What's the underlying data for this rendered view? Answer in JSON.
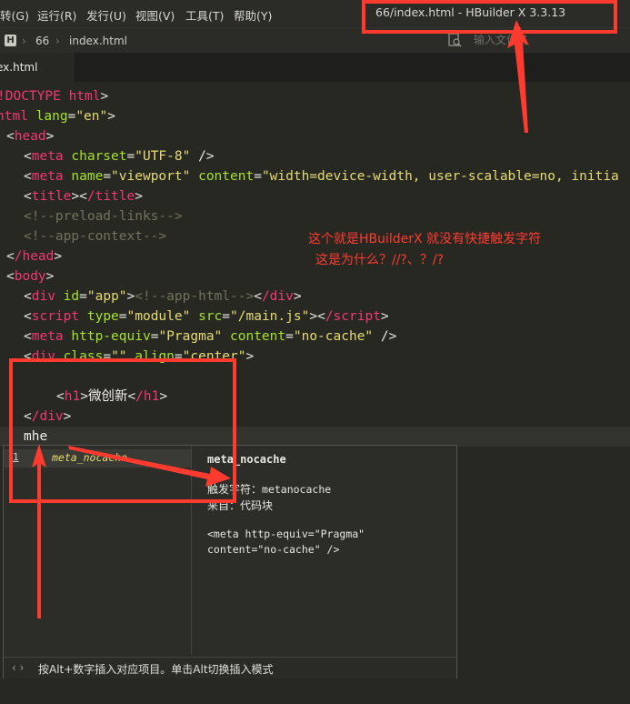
{
  "menu": [
    "转(G)",
    "运行(R)",
    "发行(U)",
    "视图(V)",
    "工具(T)",
    "帮助(Y)"
  ],
  "window_title": "66/index.html - HBuilder X 3.3.13",
  "breadcrumb": {
    "logo": "H",
    "project": "66",
    "file": "index.html"
  },
  "file_search_placeholder": "输入文件名",
  "tab": {
    "label": "ex.html"
  },
  "code": {
    "l1_doctype": "!DOCTYPE",
    "l1_html": "html",
    "l2_tag": "html",
    "l2_attr": "lang",
    "l2_val": "\"en\"",
    "l3_tag": "head",
    "l4_tag": "meta",
    "l4_attr": "charset",
    "l4_val": "\"UTF-8\"",
    "l5_tag": "meta",
    "l5_attr1": "name",
    "l5_val1": "\"viewport\"",
    "l5_attr2": "content",
    "l5_val2": "\"width=device-width, user-scalable=no, initia",
    "l6_tag": "title",
    "l6_tag_close": "/title",
    "l7_cmt": "<!--preload-links-->",
    "l8_cmt": "<!--app-context-->",
    "l9_tag": "/head",
    "l10_tag": "body",
    "l11_tag": "div",
    "l11_attr": "id",
    "l11_val": "\"app\"",
    "l11_cmt": "<!--app-html-->",
    "l11_close": "/div",
    "l12_tag": "script",
    "l12_attr1": "type",
    "l12_val1": "\"module\"",
    "l12_attr2": "src",
    "l12_val2": "\"/main.js\"",
    "l12_close": "/script",
    "l13_tag": "meta",
    "l13_attr1": "http-equiv",
    "l13_val1": "\"Pragma\"",
    "l13_attr2": "content",
    "l13_val2": "\"no-cache\"",
    "l14_tag": "div",
    "l14_attr1": "class",
    "l14_val1": "\"\"",
    "l14_attr2": "align",
    "l14_val2": "\"center\"",
    "l16_tag": "h1",
    "l16_text": "微创新",
    "l16_close": "/h1",
    "l17_tag": "/div",
    "l18_text": "mhe"
  },
  "annotation": {
    "line1": "这个就是HBuilderX  就没有快捷触发字符",
    "line2": "这是为什么？//?、？/?"
  },
  "autocomplete": {
    "items": [
      {
        "index": "1",
        "label": "meta_nocache"
      }
    ],
    "detail_title": "meta_nocache",
    "trigger_label": "触发字符：",
    "trigger_value": "metanocache",
    "source": "来自：代码块",
    "code_line1": "<meta http-equiv=\"Pragma\"",
    "code_line2": "content=\"no-cache\" />",
    "footer_arrows": "‹ ›",
    "footer": "按Alt+数字插入对应项目。单击Alt切换插入模式"
  },
  "colors": {
    "annotation": "#ff3b30",
    "tag": "#f2396f",
    "attr": "#a6e22e",
    "string": "#e6db74",
    "comment": "#75715e"
  }
}
